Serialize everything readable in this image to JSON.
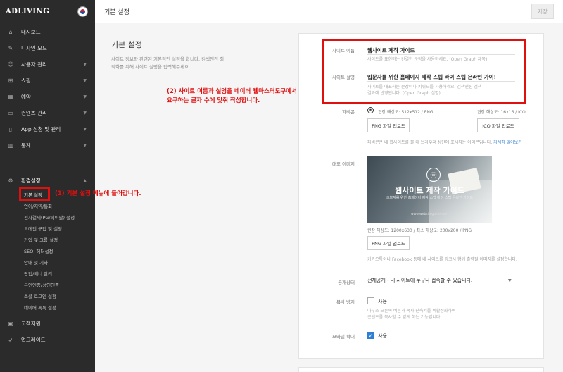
{
  "brand": "ADLIVING",
  "topbar": {
    "title": "기본 설정",
    "save": "저장"
  },
  "nav": {
    "items": [
      {
        "label": "대시보드",
        "icon": "home-icon"
      },
      {
        "label": "디자인 모드",
        "icon": "brush-icon"
      },
      {
        "label": "사용자 관리",
        "icon": "user-icon"
      },
      {
        "label": "쇼핑",
        "icon": "cart-icon"
      },
      {
        "label": "예약",
        "icon": "calendar-icon"
      },
      {
        "label": "컨텐츠 관리",
        "icon": "inbox-icon"
      },
      {
        "label": "App 신청 및 관리",
        "icon": "phone-icon"
      },
      {
        "label": "통계",
        "icon": "bar-chart-icon"
      }
    ],
    "settings": "환경설정",
    "sub": [
      "기본 설정",
      "언어/지역/통화",
      "전자결제(PG/페이팔) 설정",
      "도메인 구입 및 설정",
      "가입 및 그룹 설정",
      "SEO, 헤더설정",
      "안내 및 기타",
      "팝업/배너 관리",
      "본인인증/성인인증",
      "소셜 로그인 설정",
      "네이버 톡톡 설정"
    ],
    "support": "고객지원",
    "upgrade": "업그레이드"
  },
  "section": {
    "title": "기본 설정",
    "desc1": "사이트 정보와 관련된 기본적인 설정을 합니다. 검색엔진 최",
    "desc2": "적화를 위해 사이트 설명을 입력해주세요."
  },
  "site_name": {
    "label": "사이트 이름",
    "value": "웹사이트 제작 가이드",
    "help": "사이트를 표현하는 간결한 문장을 사용하세요. (Open Graph 제목)"
  },
  "site_desc": {
    "label": "사이트 설명",
    "value": "입문자를 위한 홈페이지 제작 스텝 바이 스텝 온라인 가이!",
    "help1": "사이트를 대표하는 문장이나 키워드를 사용하세요. 검색엔진 검색",
    "help2": "결과에 반영됩니다. (Open Graph 설명)"
  },
  "favicon": {
    "label": "파비콘",
    "png_size": "권장 해상도: 512x512 / PNG",
    "ico_size": "권장 해상도: 16x16 / ICO",
    "png_btn": "PNG 파일 업로드",
    "ico_btn": "ICO 파일 업로드",
    "help": "파비콘은 내 웹사이트를 볼 때 브라우저 상단에 표시되는 아이콘입니다.",
    "more": "자세히 알아보기"
  },
  "rep_image": {
    "label": "대표 이미지",
    "hero_title": "웹사이트 제작 가이드",
    "hero_sub": "초보자를 위한 홈페이지 제작 스텝 바이 스텝 온라인 가이드",
    "hero_url": "www.websiteguide.com",
    "size": "권장 해상도: 1200x630 / 최소 해상도: 200x200 / PNG",
    "png_btn": "PNG 파일 업로드",
    "help": "카카오톡이나 Facebook 등에 내 사이트를 링크시 함께 출력될 이미지를 설정합니다."
  },
  "visibility": {
    "label": "공개상태",
    "value": "전체공개 - 내 사이트에 누구나 접속할 수 있습니다."
  },
  "copy_protect": {
    "label": "복사 방지",
    "option": "사용",
    "help1": "마우스 오른쪽 버튼과 복사 단축키를 비활성화하여",
    "help2": "콘텐츠를 복사할 수 없게 하는 기능입니다."
  },
  "mobile_zoom": {
    "label": "모바일 확대",
    "option": "사용"
  },
  "annotations": {
    "a1": "(1) 기본 설정 메뉴에 들어갑니다.",
    "a2_line1": "(2) 사이트 이름과 설명을 네이버 웹마스터도구에서",
    "a2_line2": "요구하는 글자 수에 맞춰 작성합니다."
  }
}
